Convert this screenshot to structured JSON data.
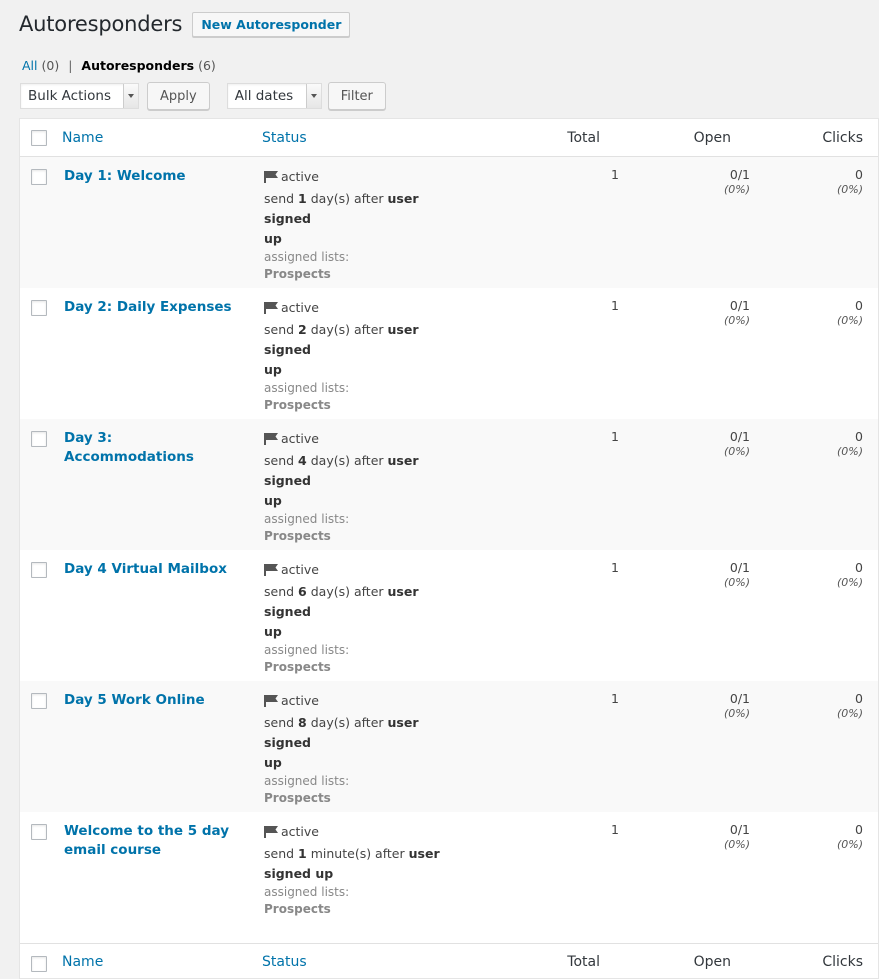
{
  "header": {
    "title": "Autoresponders",
    "new_button": "New Autoresponder"
  },
  "views": {
    "all_label": "All",
    "all_count": "(0)",
    "separator": "|",
    "current_label": "Autoresponders",
    "current_count": "(6)"
  },
  "toolbar": {
    "bulk_actions": "Bulk Actions",
    "apply": "Apply",
    "dates": "All dates",
    "filter": "Filter"
  },
  "columns": {
    "name": "Name",
    "status": "Status",
    "total": "Total",
    "open": "Open",
    "clicks": "Clicks"
  },
  "rows": [
    {
      "name": "Day 1: Welcome",
      "status": "active",
      "send_prefix": "send",
      "send_count": "1",
      "send_mid": "day(s) after",
      "send_event_1": "user signed",
      "send_event_2": "up",
      "assigned_label": "assigned lists:",
      "list": "Prospects",
      "total": "1",
      "open": "0/1",
      "open_pct": "(0%)",
      "clicks": "0",
      "clicks_pct": "(0%)"
    },
    {
      "name": "Day 2: Daily Expenses",
      "status": "active",
      "send_prefix": "send",
      "send_count": "2",
      "send_mid": "day(s) after",
      "send_event_1": "user signed",
      "send_event_2": "up",
      "assigned_label": "assigned lists:",
      "list": "Prospects",
      "total": "1",
      "open": "0/1",
      "open_pct": "(0%)",
      "clicks": "0",
      "clicks_pct": "(0%)"
    },
    {
      "name": "Day 3: Accommodations",
      "status": "active",
      "send_prefix": "send",
      "send_count": "4",
      "send_mid": "day(s) after",
      "send_event_1": "user signed",
      "send_event_2": "up",
      "assigned_label": "assigned lists:",
      "list": "Prospects",
      "total": "1",
      "open": "0/1",
      "open_pct": "(0%)",
      "clicks": "0",
      "clicks_pct": "(0%)"
    },
    {
      "name": "Day 4 Virtual Mailbox",
      "status": "active",
      "send_prefix": "send",
      "send_count": "6",
      "send_mid": "day(s) after",
      "send_event_1": "user signed",
      "send_event_2": "up",
      "assigned_label": "assigned lists:",
      "list": "Prospects",
      "total": "1",
      "open": "0/1",
      "open_pct": "(0%)",
      "clicks": "0",
      "clicks_pct": "(0%)"
    },
    {
      "name": "Day 5 Work Online",
      "status": "active",
      "send_prefix": "send",
      "send_count": "8",
      "send_mid": "day(s) after",
      "send_event_1": "user signed",
      "send_event_2": "up",
      "assigned_label": "assigned lists:",
      "list": "Prospects",
      "total": "1",
      "open": "0/1",
      "open_pct": "(0%)",
      "clicks": "0",
      "clicks_pct": "(0%)"
    },
    {
      "name": "Welcome to the 5 day email course",
      "status": "active",
      "send_prefix": "send",
      "send_count": "1",
      "send_mid": "minute(s) after",
      "send_event_1": "user",
      "send_event_2": "signed up",
      "assigned_label": "assigned lists:",
      "list": "Prospects",
      "total": "1",
      "open": "0/1",
      "open_pct": "(0%)",
      "clicks": "0",
      "clicks_pct": "(0%)"
    }
  ]
}
